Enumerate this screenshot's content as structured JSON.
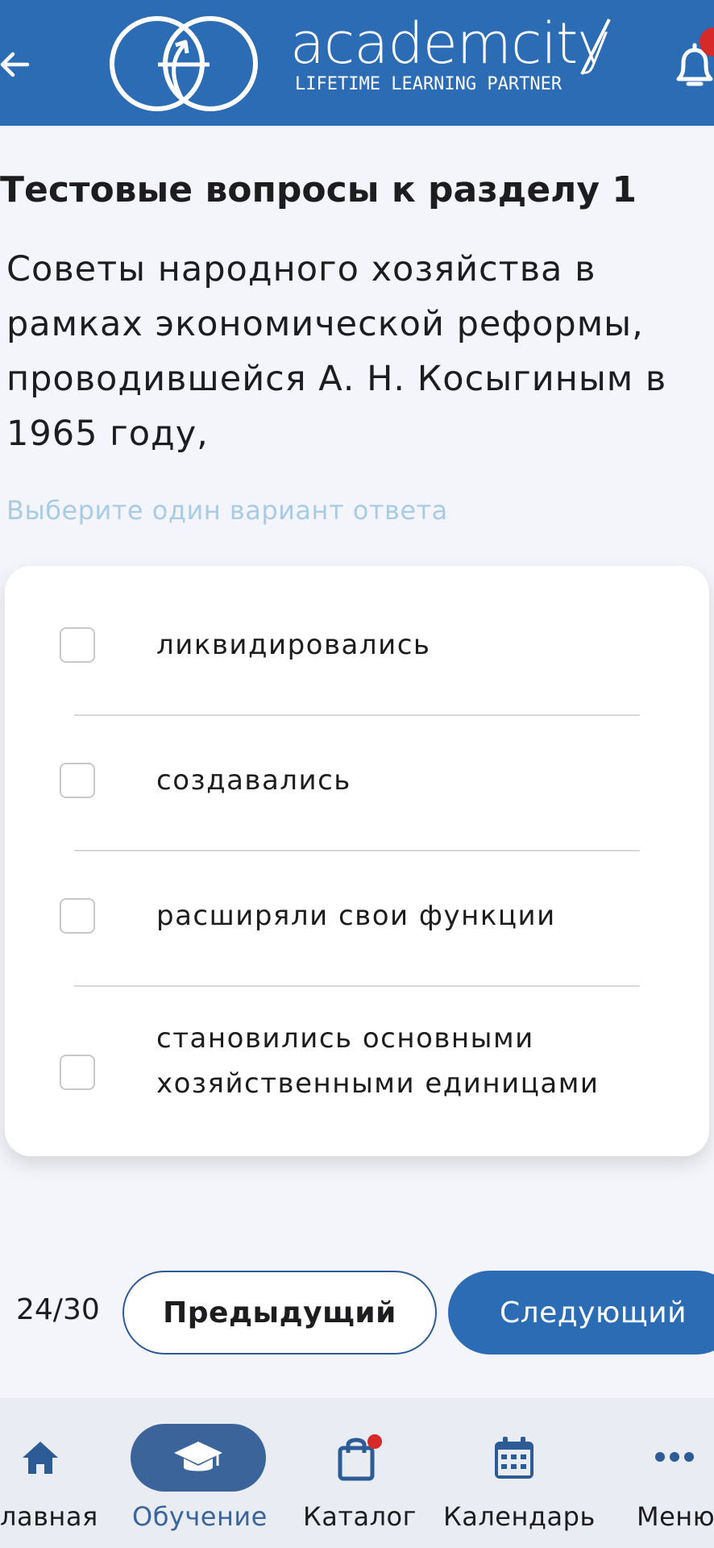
{
  "header": {
    "brand": "academcity",
    "tagline": "LIFETIME LEARNING PARTNER",
    "colors": {
      "background": "#2b6cb5",
      "badge": "#d62a2a"
    },
    "icons": [
      "back-arrow-icon",
      "logo-icon",
      "bell-icon"
    ]
  },
  "section_title": "Тестовые вопросы к разделу 1",
  "question": "Советы народного хозяйства в рамках экономической реформы, проводившейся А. Н. Косыгиным в 1965 году,",
  "hint": "Выберите один вариант ответа",
  "options": [
    {
      "label": "ликвидировались",
      "checked": false
    },
    {
      "label": "создавались",
      "checked": false
    },
    {
      "label": "расширяли свои функции",
      "checked": false
    },
    {
      "label": "становились основными хозяйственными единицами",
      "checked": false
    }
  ],
  "pagination": {
    "counter": "24/30",
    "prev_label": "Предыдущий",
    "next_label": "Следующий"
  },
  "tabbar": {
    "items": [
      {
        "label": "лавная",
        "icon": "home-icon",
        "active": false
      },
      {
        "label": "Обучение",
        "icon": "graduation-cap-icon",
        "active": true
      },
      {
        "label": "Каталог",
        "icon": "shopping-bag-icon",
        "active": false
      },
      {
        "label": "Календарь",
        "icon": "calendar-icon",
        "active": false
      },
      {
        "label": "Меню",
        "icon": "more-dots-icon",
        "active": false
      }
    ],
    "colors": {
      "active": "#3a649a",
      "icon": "#2c5b95"
    }
  }
}
